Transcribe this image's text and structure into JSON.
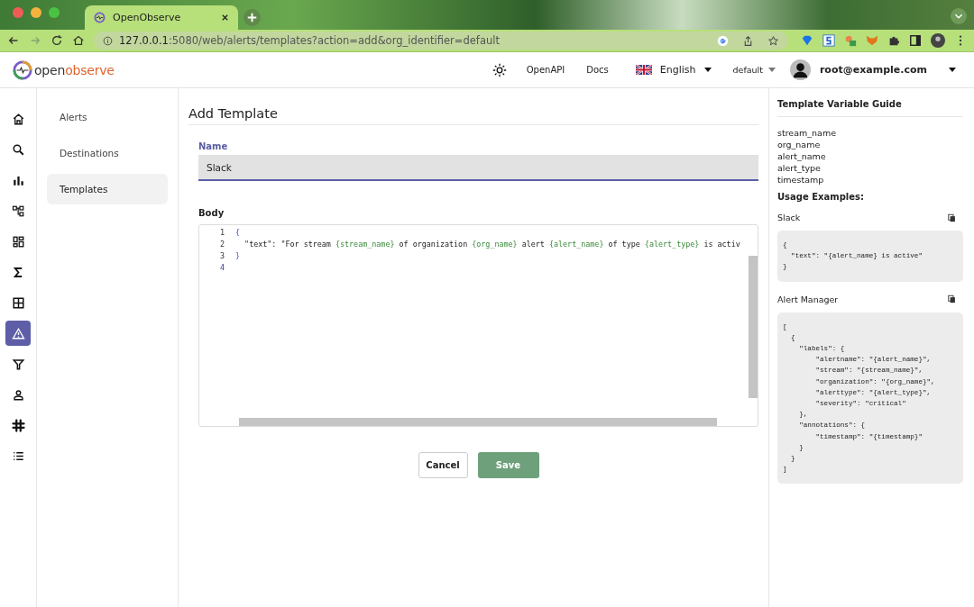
{
  "browser": {
    "tab_title": "OpenObserve",
    "url_host": "127.0.0.1",
    "url_rest": ":5080/web/alerts/templates?action=add&org_identifier=default"
  },
  "header": {
    "logo_part_1": "open",
    "logo_part_2": "observe",
    "links": [
      "OpenAPI",
      "Docs"
    ],
    "language": "English",
    "org": "default",
    "user": "root@example.com"
  },
  "rail": [
    {
      "selected": false
    },
    {
      "selected": false
    },
    {
      "selected": false
    },
    {
      "selected": false
    },
    {
      "selected": false
    },
    {
      "selected": false
    },
    {
      "selected": false
    },
    {
      "selected": true
    },
    {
      "selected": false
    },
    {
      "selected": false
    },
    {
      "selected": false
    },
    {
      "selected": false
    }
  ],
  "submenu": [
    {
      "label": "Alerts",
      "selected": false
    },
    {
      "label": "Destinations",
      "selected": false
    },
    {
      "label": "Templates",
      "selected": true
    }
  ],
  "page_title": "Add Template",
  "name_field": {
    "label": "Name",
    "value": "Slack"
  },
  "body": {
    "label": "Body",
    "lines": [
      {
        "number": "1",
        "segments": [
          {
            "kind": "brace",
            "text": "{"
          }
        ]
      },
      {
        "number": "2",
        "segments": [
          {
            "kind": "plain",
            "text": "  \"text\": \"For stream "
          },
          {
            "kind": "var",
            "text": "{stream_name}"
          },
          {
            "kind": "plain",
            "text": " of organization "
          },
          {
            "kind": "var",
            "text": "{org_name}"
          },
          {
            "kind": "plain",
            "text": " alert "
          },
          {
            "kind": "var",
            "text": "{alert_name}"
          },
          {
            "kind": "plain",
            "text": " of type "
          },
          {
            "kind": "var",
            "text": "{alert_type}"
          },
          {
            "kind": "plain",
            "text": " is activ"
          }
        ]
      },
      {
        "number": "3",
        "segments": [
          {
            "kind": "brace",
            "text": "}"
          }
        ]
      },
      {
        "number": "4"
      }
    ]
  },
  "buttons": {
    "cancel": "Cancel",
    "save": "Save"
  },
  "guide": {
    "title": "Template Variable Guide",
    "variables": [
      "stream_name",
      "org_name",
      "alert_name",
      "alert_type",
      "timestamp"
    ],
    "examples_title": "Usage Examples:",
    "examples": [
      {
        "name": "Slack",
        "code": [
          "{",
          "  \"text\": \"{alert_name} is active\"",
          "}"
        ]
      },
      {
        "name": "Alert Manager",
        "code": [
          "[",
          "  {",
          "    \"labels\": {",
          "        \"alertname\": \"{alert_name}\",",
          "        \"stream\": \"{stream_name}\",",
          "        \"organization\": \"{org_name}\",",
          "        \"alerttype\": \"{alert_type}\",",
          "        \"severity\": \"critical\"",
          "    },",
          "    \"annotations\": {",
          "        \"timestamp\": \"{timestamp}\"",
          "    }",
          "  }",
          "]"
        ]
      }
    ]
  }
}
